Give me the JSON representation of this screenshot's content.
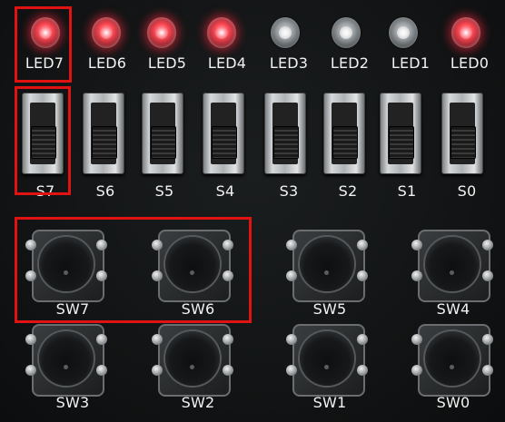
{
  "leds": [
    {
      "label": "LED7",
      "on": true
    },
    {
      "label": "LED6",
      "on": true
    },
    {
      "label": "LED5",
      "on": true
    },
    {
      "label": "LED4",
      "on": true
    },
    {
      "label": "LED3",
      "on": false
    },
    {
      "label": "LED2",
      "on": false
    },
    {
      "label": "LED1",
      "on": false
    },
    {
      "label": "LED0",
      "on": true
    }
  ],
  "slide_switches": [
    "S7",
    "S6",
    "S5",
    "S4",
    "S3",
    "S2",
    "S1",
    "S0"
  ],
  "push_buttons_top": [
    "SW7",
    "SW6",
    "SW5",
    "SW4"
  ],
  "push_buttons_bottom": [
    "SW3",
    "SW2",
    "SW1",
    "SW0"
  ],
  "highlight_color": "#e01212"
}
